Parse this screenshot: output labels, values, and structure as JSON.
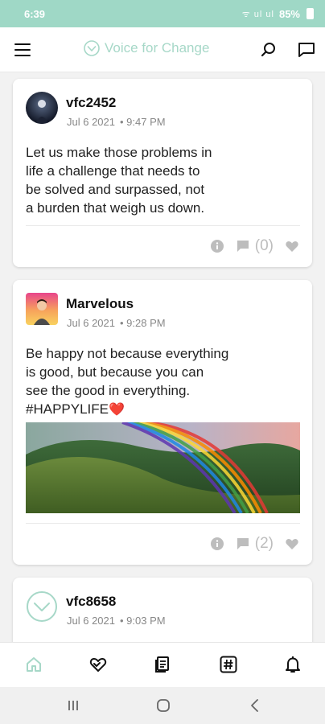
{
  "status_bar": {
    "time": "6:39",
    "signal": "ᯤ ul ul",
    "battery": "85%"
  },
  "app": {
    "title": "Voice for Change",
    "accent": "#a7d8c8",
    "status_color": "#9fd8c6"
  },
  "posts": [
    {
      "username": "vfc2452",
      "date": "Jul 6 2021",
      "time": "• 9:47 PM",
      "text_lines": [
        "Let us make those problems in",
        "life a challenge that needs to",
        "be solved and surpassed, not",
        "a burden that weigh us down."
      ],
      "comment_count": "(0)"
    },
    {
      "username": "Marvelous",
      "date": "Jul 6 2021",
      "time": "• 9:28 PM",
      "text_lines": [
        "Be happy not because everything",
        "is good, but because you  can",
        "see the good in everything.",
        "#HAPPYLIFE"
      ],
      "emoji": "❤️",
      "comment_count": "(2)"
    },
    {
      "username": "vfc8658",
      "date": "Jul 6 2021",
      "time": "• 9:03 PM"
    }
  ]
}
